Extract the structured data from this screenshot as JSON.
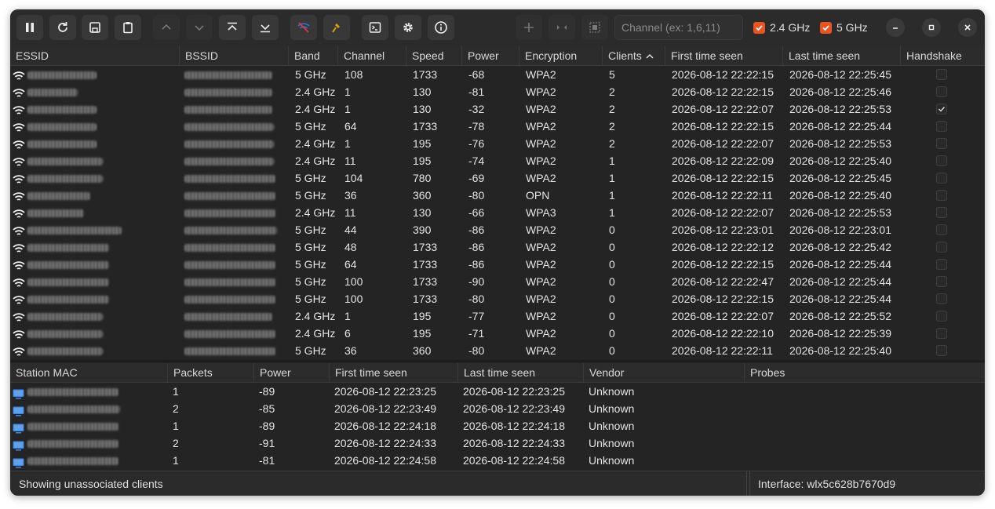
{
  "toolbar": {
    "channel_placeholder": "Channel (ex: 1,6,11)",
    "band_24_label": "2.4 GHz",
    "band_5_label": "5 GHz",
    "band_24_checked": true,
    "band_5_checked": true,
    "accent_color": "#e95420"
  },
  "ap_table": {
    "columns": [
      "ESSID",
      "BSSID",
      "Band",
      "Channel",
      "Speed",
      "Power",
      "Encryption",
      "Clients",
      "First time seen",
      "Last time seen",
      "Handshake"
    ],
    "sort_column": "Clients",
    "sort_direction": "descending",
    "rows": [
      {
        "band": "5 GHz",
        "channel": "108",
        "speed": "1733",
        "power": "-68",
        "encryption": "WPA2",
        "clients": "5",
        "first_seen": "2026-08-12 22:22:15",
        "last_seen": "2026-08-12 22:25:45",
        "handshake": false
      },
      {
        "band": "2.4 GHz",
        "channel": "1",
        "speed": "130",
        "power": "-81",
        "encryption": "WPA2",
        "clients": "2",
        "first_seen": "2026-08-12 22:22:15",
        "last_seen": "2026-08-12 22:25:46",
        "handshake": false
      },
      {
        "band": "2.4 GHz",
        "channel": "1",
        "speed": "130",
        "power": "-32",
        "encryption": "WPA2",
        "clients": "2",
        "first_seen": "2026-08-12 22:22:07",
        "last_seen": "2026-08-12 22:25:53",
        "handshake": true
      },
      {
        "band": "5 GHz",
        "channel": "64",
        "speed": "1733",
        "power": "-78",
        "encryption": "WPA2",
        "clients": "2",
        "first_seen": "2026-08-12 22:22:15",
        "last_seen": "2026-08-12 22:25:44",
        "handshake": false
      },
      {
        "band": "2.4 GHz",
        "channel": "1",
        "speed": "195",
        "power": "-76",
        "encryption": "WPA2",
        "clients": "2",
        "first_seen": "2026-08-12 22:22:07",
        "last_seen": "2026-08-12 22:25:53",
        "handshake": false
      },
      {
        "band": "2.4 GHz",
        "channel": "11",
        "speed": "195",
        "power": "-74",
        "encryption": "WPA2",
        "clients": "1",
        "first_seen": "2026-08-12 22:22:09",
        "last_seen": "2026-08-12 22:25:40",
        "handshake": false
      },
      {
        "band": "5 GHz",
        "channel": "104",
        "speed": "780",
        "power": "-69",
        "encryption": "WPA2",
        "clients": "1",
        "first_seen": "2026-08-12 22:22:15",
        "last_seen": "2026-08-12 22:25:45",
        "handshake": false
      },
      {
        "band": "5 GHz",
        "channel": "36",
        "speed": "360",
        "power": "-80",
        "encryption": "OPN",
        "clients": "1",
        "first_seen": "2026-08-12 22:22:11",
        "last_seen": "2026-08-12 22:25:40",
        "handshake": false
      },
      {
        "band": "2.4 GHz",
        "channel": "11",
        "speed": "130",
        "power": "-66",
        "encryption": "WPA3",
        "clients": "1",
        "first_seen": "2026-08-12 22:22:07",
        "last_seen": "2026-08-12 22:25:53",
        "handshake": false
      },
      {
        "band": "5 GHz",
        "channel": "44",
        "speed": "390",
        "power": "-86",
        "encryption": "WPA2",
        "clients": "0",
        "first_seen": "2026-08-12 22:23:01",
        "last_seen": "2026-08-12 22:23:01",
        "handshake": false
      },
      {
        "band": "5 GHz",
        "channel": "48",
        "speed": "1733",
        "power": "-86",
        "encryption": "WPA2",
        "clients": "0",
        "first_seen": "2026-08-12 22:22:12",
        "last_seen": "2026-08-12 22:25:42",
        "handshake": false
      },
      {
        "band": "5 GHz",
        "channel": "64",
        "speed": "1733",
        "power": "-86",
        "encryption": "WPA2",
        "clients": "0",
        "first_seen": "2026-08-12 22:22:15",
        "last_seen": "2026-08-12 22:25:44",
        "handshake": false
      },
      {
        "band": "5 GHz",
        "channel": "100",
        "speed": "1733",
        "power": "-90",
        "encryption": "WPA2",
        "clients": "0",
        "first_seen": "2026-08-12 22:22:47",
        "last_seen": "2026-08-12 22:25:44",
        "handshake": false
      },
      {
        "band": "5 GHz",
        "channel": "100",
        "speed": "1733",
        "power": "-80",
        "encryption": "WPA2",
        "clients": "0",
        "first_seen": "2026-08-12 22:22:15",
        "last_seen": "2026-08-12 22:25:44",
        "handshake": false
      },
      {
        "band": "2.4 GHz",
        "channel": "1",
        "speed": "195",
        "power": "-77",
        "encryption": "WPA2",
        "clients": "0",
        "first_seen": "2026-08-12 22:22:07",
        "last_seen": "2026-08-12 22:25:52",
        "handshake": false
      },
      {
        "band": "2.4 GHz",
        "channel": "6",
        "speed": "195",
        "power": "-71",
        "encryption": "WPA2",
        "clients": "0",
        "first_seen": "2026-08-12 22:22:10",
        "last_seen": "2026-08-12 22:25:39",
        "handshake": false
      },
      {
        "band": "5 GHz",
        "channel": "36",
        "speed": "360",
        "power": "-80",
        "encryption": "WPA2",
        "clients": "0",
        "first_seen": "2026-08-12 22:22:11",
        "last_seen": "2026-08-12 22:25:40",
        "handshake": false
      }
    ]
  },
  "station_table": {
    "columns": [
      "Station MAC",
      "Packets",
      "Power",
      "First time seen",
      "Last time seen",
      "Vendor",
      "Probes"
    ],
    "rows": [
      {
        "packets": "1",
        "power": "-89",
        "first_seen": "2026-08-12 22:23:25",
        "last_seen": "2026-08-12 22:23:25",
        "vendor": "Unknown",
        "probes": ""
      },
      {
        "packets": "2",
        "power": "-85",
        "first_seen": "2026-08-12 22:23:49",
        "last_seen": "2026-08-12 22:23:49",
        "vendor": "Unknown",
        "probes": ""
      },
      {
        "packets": "1",
        "power": "-89",
        "first_seen": "2026-08-12 22:24:18",
        "last_seen": "2026-08-12 22:24:18",
        "vendor": "Unknown",
        "probes": ""
      },
      {
        "packets": "2",
        "power": "-91",
        "first_seen": "2026-08-12 22:24:33",
        "last_seen": "2026-08-12 22:24:33",
        "vendor": "Unknown",
        "probes": ""
      },
      {
        "packets": "1",
        "power": "-81",
        "first_seen": "2026-08-12 22:24:58",
        "last_seen": "2026-08-12 22:24:58",
        "vendor": "Unknown",
        "probes": ""
      }
    ]
  },
  "status": {
    "left": "Showing unassociated clients",
    "right": "Interface: wlx5c628b7670d9"
  }
}
